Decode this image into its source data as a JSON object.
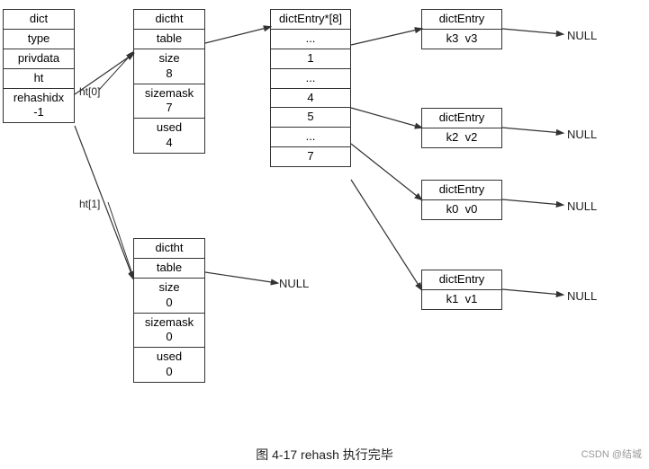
{
  "diagram": {
    "title": "图 4-17   rehash 执行完毕",
    "watermark": "CSDN @结城",
    "dict_box": {
      "cells": [
        "dict",
        "type",
        "privdata",
        "ht",
        "rehashidx\n-1"
      ]
    },
    "ht0_label": "ht[0]",
    "ht1_label": "ht[1]",
    "dictht0_box": {
      "cells": [
        "dictht",
        "table",
        "size\n8",
        "sizemask\n7",
        "used\n4"
      ]
    },
    "dictht1_box": {
      "cells": [
        "dictht",
        "table",
        "size\n0",
        "sizemask\n0",
        "used\n0"
      ]
    },
    "array_box": {
      "cells": [
        "dictEntry*[8]",
        "...",
        "1",
        "...",
        "4",
        "5",
        "...",
        "7"
      ]
    },
    "null_label": "NULL",
    "entries": [
      {
        "id": "e0",
        "cells": [
          "dictEntry",
          "k3  v3"
        ],
        "null": "NULL"
      },
      {
        "id": "e1",
        "cells": [
          "dictEntry",
          "k2  v2"
        ],
        "null": "NULL"
      },
      {
        "id": "e2",
        "cells": [
          "dictEntry",
          "k0  v0"
        ],
        "null": "NULL"
      },
      {
        "id": "e3",
        "cells": [
          "dictEntry",
          "k1  v1"
        ],
        "null": "NULL"
      }
    ]
  }
}
